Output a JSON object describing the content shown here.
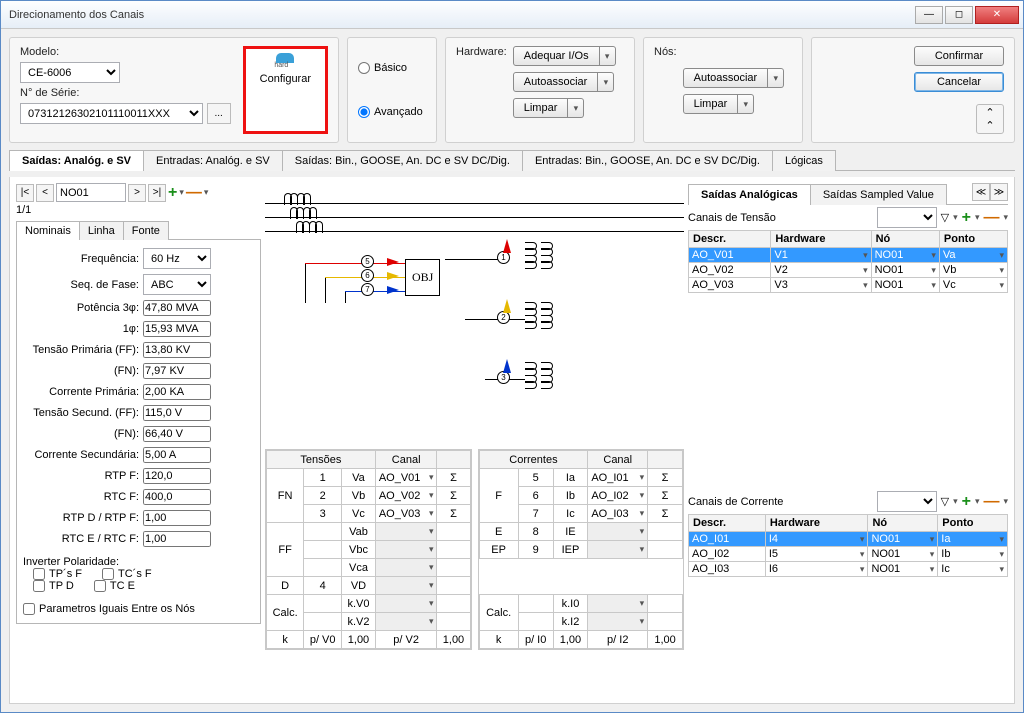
{
  "window": {
    "title": "Direcionamento dos Canais"
  },
  "topleft": {
    "modelo_label": "Modelo:",
    "modelo_value": "CE-6006",
    "serie_label": "N° de Série:",
    "serie_value": "07312126302101110011XXX",
    "browse": "...",
    "configurar": "Configurar"
  },
  "mode": {
    "basico": "Básico",
    "avancado": "Avançado"
  },
  "hardware": {
    "label": "Hardware:",
    "adequar": "Adequar I/Os",
    "auto": "Autoassociar",
    "limpar": "Limpar"
  },
  "nos": {
    "label": "Nós:",
    "auto": "Autoassociar",
    "limpar": "Limpar"
  },
  "actions": {
    "confirmar": "Confirmar",
    "cancelar": "Cancelar"
  },
  "tabs": {
    "t1": "Saídas: Analóg. e SV",
    "t2": "Entradas: Analóg. e SV",
    "t3": "Saídas: Bin., GOOSE, An. DC e SV DC/Dig.",
    "t4": "Entradas: Bin., GOOSE, An. DC e SV DC/Dig.",
    "t5": "Lógicas"
  },
  "nav": {
    "node": "NO01",
    "count": "1/1"
  },
  "subtabs": {
    "nominais": "Nominais",
    "linha": "Linha",
    "fonte": "Fonte"
  },
  "nominal": {
    "freq_l": "Frequência:",
    "freq_v": "60 Hz",
    "seq_l": "Seq. de Fase:",
    "seq_v": "ABC",
    "pot3_l": "Potência 3φ:",
    "pot3_v": "47,80 MVA",
    "pot1_l": "1φ:",
    "pot1_v": "15,93 MVA",
    "tpff_l": "Tensão Primária (FF):",
    "tpff_v": "13,80 KV",
    "tpfn_l": "(FN):",
    "tpfn_v": "7,97 KV",
    "cp_l": "Corrente Primária:",
    "cp_v": "2,00 KA",
    "tsff_l": "Tensão Secund. (FF):",
    "tsff_v": "115,0 V",
    "tsfn_l": "(FN):",
    "tsfn_v": "66,40 V",
    "cs_l": "Corrente Secundária:",
    "cs_v": "5,00 A",
    "rtpf_l": "RTP F:",
    "rtpf_v": "120,0",
    "rtcf_l": "RTC F:",
    "rtcf_v": "400,0",
    "rtpd_l": "RTP D / RTP F:",
    "rtpd_v": "1,00",
    "rtce_l": "RTC E / RTC F:",
    "rtce_v": "1,00",
    "inv_l": "Inverter Polaridade:",
    "tpsf": "TP´s F",
    "tcsf": "TC´s F",
    "tpd": "TP D",
    "tce": "TC E",
    "param": "Parametros Iguais Entre os Nós"
  },
  "diagram": {
    "obj": "OBJ"
  },
  "tensoes": {
    "h_t": "Tensões",
    "h_c": "Canal",
    "fn": "FN",
    "ff": "FF",
    "d": "D",
    "calc": "Calc.",
    "k": "k",
    "r": [
      {
        "n": "1",
        "nm": "Va",
        "ch": "AO_V01"
      },
      {
        "n": "2",
        "nm": "Vb",
        "ch": "AO_V02"
      },
      {
        "n": "3",
        "nm": "Vc",
        "ch": "AO_V03"
      }
    ],
    "ff_r": [
      "Vab",
      "Vbc",
      "Vca"
    ],
    "d_n": "4",
    "d_nm": "VD",
    "calc_r": [
      "k.V0",
      "k.V2"
    ],
    "pv0": "p/ V0",
    "pv0_v": "1,00",
    "pv2": "p/ V2",
    "pv2_v": "1,00"
  },
  "correntes": {
    "h_t": "Correntes",
    "h_c": "Canal",
    "f": "F",
    "e": "E",
    "ep": "EP",
    "calc": "Calc.",
    "k": "k",
    "r": [
      {
        "n": "5",
        "nm": "Ia",
        "ch": "AO_I01"
      },
      {
        "n": "6",
        "nm": "Ib",
        "ch": "AO_I02"
      },
      {
        "n": "7",
        "nm": "Ic",
        "ch": "AO_I03"
      }
    ],
    "e_n": "8",
    "e_nm": "IE",
    "ep_n": "9",
    "ep_nm": "IEP",
    "calc_r": [
      "k.I0",
      "k.I2"
    ],
    "pi0": "p/ I0",
    "pi0_v": "1,00",
    "pi2": "p/ I2",
    "pi2_v": "1,00"
  },
  "right": {
    "tab_sa": "Saídas Analógicas",
    "tab_ssv": "Saídas Sampled Value",
    "ct_label": "Canais de Tensão",
    "cc_label": "Canais de Corrente",
    "h_desc": "Descr.",
    "h_hw": "Hardware",
    "h_no": "Nó",
    "h_pt": "Ponto",
    "vt": [
      {
        "d": "AO_V01",
        "h": "V1",
        "n": "NO01",
        "p": "Va"
      },
      {
        "d": "AO_V02",
        "h": "V2",
        "n": "NO01",
        "p": "Vb"
      },
      {
        "d": "AO_V03",
        "h": "V3",
        "n": "NO01",
        "p": "Vc"
      }
    ],
    "ct": [
      {
        "d": "AO_I01",
        "h": "I4",
        "n": "NO01",
        "p": "Ia"
      },
      {
        "d": "AO_I02",
        "h": "I5",
        "n": "NO01",
        "p": "Ib"
      },
      {
        "d": "AO_I03",
        "h": "I6",
        "n": "NO01",
        "p": "Ic"
      }
    ]
  }
}
